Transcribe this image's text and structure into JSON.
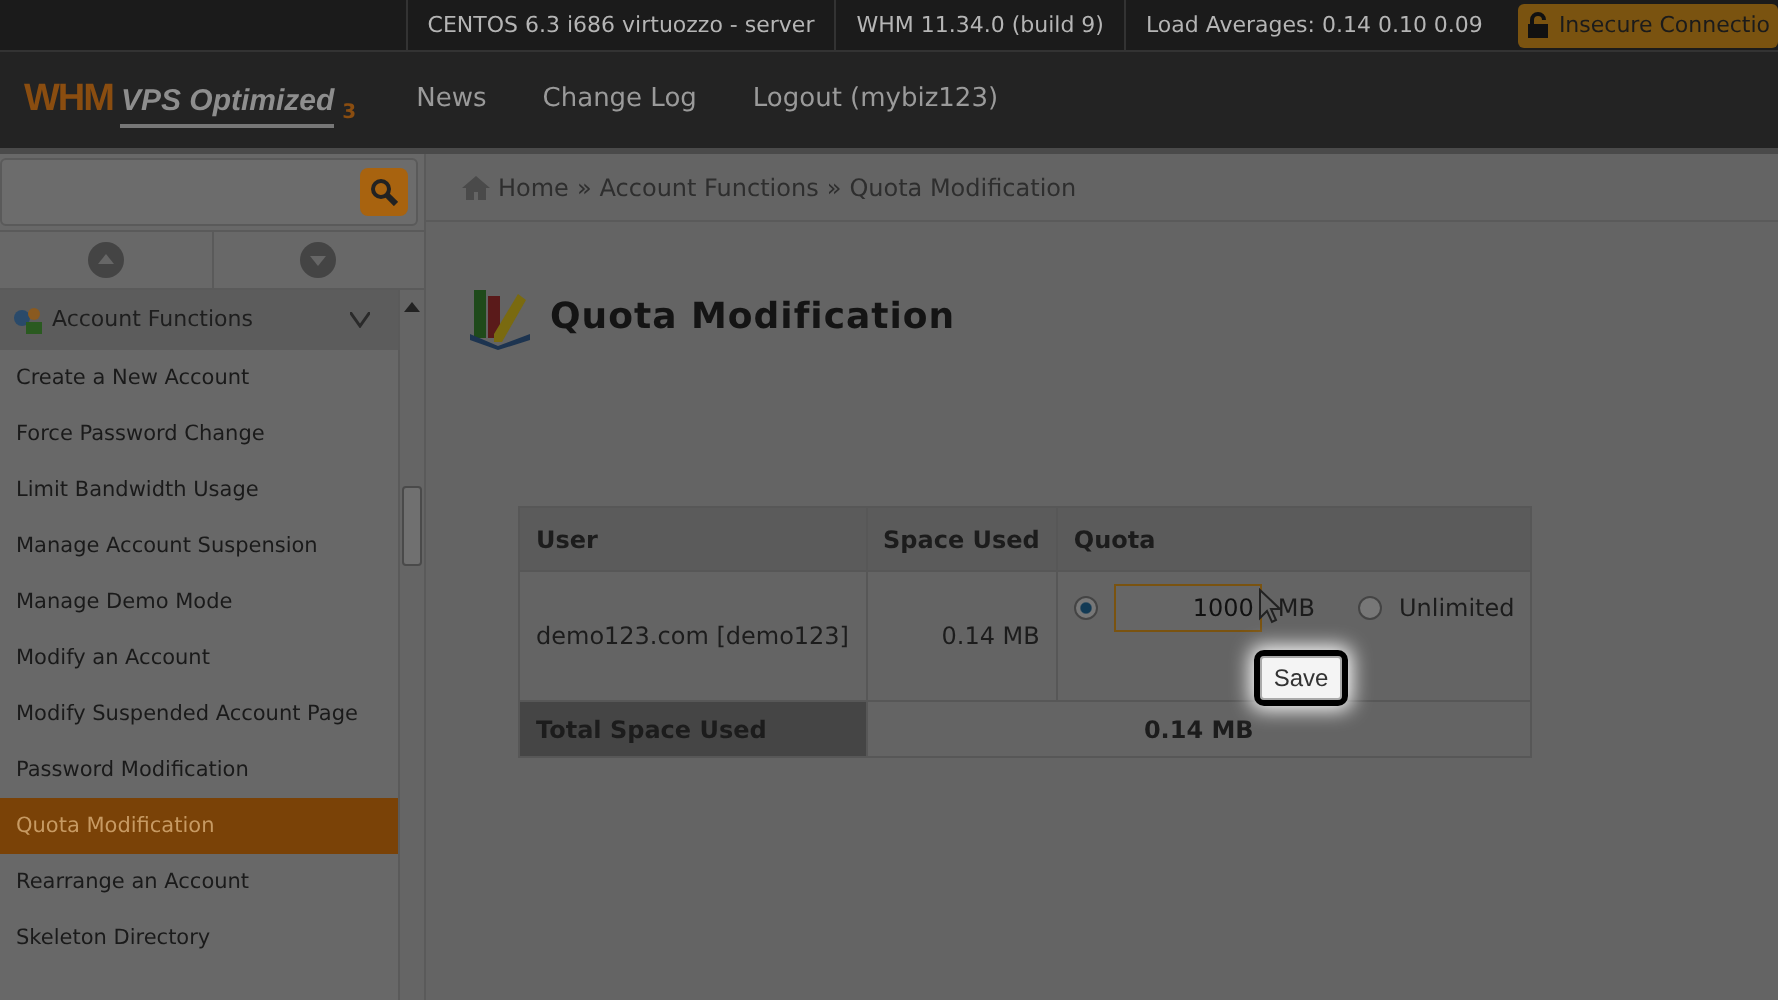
{
  "top_bar": {
    "server": "CENTOS 6.3 i686 virtuozzo - server",
    "version": "WHM 11.34.0 (build 9)",
    "load_averages": "Load Averages: 0.14 0.10 0.09",
    "security_badge": "Insecure Connectio"
  },
  "logo": {
    "brand": "WHM",
    "edition": "VPS Optimized",
    "number": "3"
  },
  "nav": [
    "News",
    "Change Log",
    "Logout (mybiz123)"
  ],
  "sidebar": {
    "group": {
      "label": "Account Functions"
    },
    "items": [
      {
        "label": "Create a New Account",
        "selected": false
      },
      {
        "label": "Force Password Change",
        "selected": false
      },
      {
        "label": "Limit Bandwidth Usage",
        "selected": false
      },
      {
        "label": "Manage Account Suspension",
        "selected": false
      },
      {
        "label": "Manage Demo Mode",
        "selected": false
      },
      {
        "label": "Modify an Account",
        "selected": false
      },
      {
        "label": "Modify Suspended Account Page",
        "selected": false
      },
      {
        "label": "Password Modification",
        "selected": false
      },
      {
        "label": "Quota Modification",
        "selected": true
      },
      {
        "label": "Rearrange an Account",
        "selected": false
      },
      {
        "label": "Skeleton Directory",
        "selected": false
      }
    ]
  },
  "breadcrumb": {
    "separator": "»",
    "items": [
      "Home",
      "Account Functions",
      "Quota Modification"
    ]
  },
  "page_title": "Quota Modification",
  "table": {
    "columns": [
      "User",
      "Space Used",
      "Quota"
    ],
    "rows": [
      {
        "user": "demo123.com [demo123]",
        "space_used": "0.14 MB",
        "quota": {
          "value": "1000",
          "unit": "MB",
          "options": [
            {
              "kind": "limit",
              "selected": true
            },
            {
              "kind": "unlimited",
              "label": "Unlimited",
              "selected": false
            }
          ],
          "button": "Save"
        }
      }
    ],
    "footer": {
      "label": "Total Space Used",
      "value": "0.14 MB"
    }
  }
}
